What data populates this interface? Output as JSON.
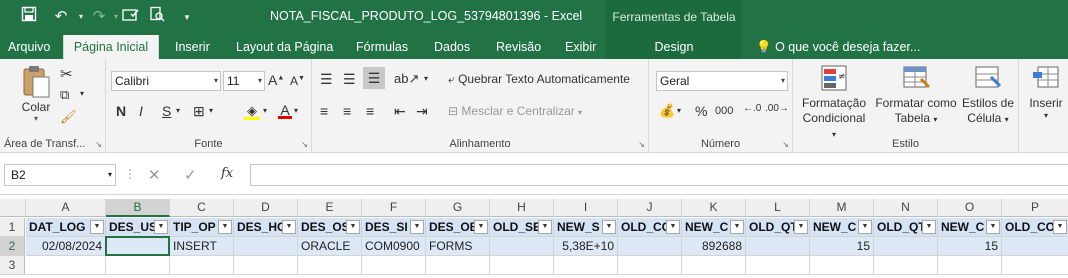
{
  "window": {
    "title": "NOTA_FISCAL_PRODUTO_LOG_53794801396 - Excel",
    "context_label": "Ferramentas de Tabela"
  },
  "tabs": [
    "Arquivo",
    "Página Inicial",
    "Inserir",
    "Layout da Página",
    "Fórmulas",
    "Dados",
    "Revisão",
    "Exibir",
    "Design"
  ],
  "tell_me": "O que você deseja fazer...",
  "ribbon": {
    "clipboard": {
      "paste": "Colar",
      "label": "Área de Transf..."
    },
    "font": {
      "name": "Calibri",
      "size": "11",
      "bold": "N",
      "italic": "I",
      "underline": "S",
      "label": "Fonte"
    },
    "alignment": {
      "wrap": "Quebrar Texto Automaticamente",
      "merge": "Mesclar e Centralizar",
      "label": "Alinhamento"
    },
    "number": {
      "format": "Geral",
      "percent": "%",
      "comma": "000",
      "label": "Número"
    },
    "styles": {
      "conditional": [
        "Formatação",
        "Condicional"
      ],
      "as_table": [
        "Formatar como",
        "Tabela"
      ],
      "cell_styles": [
        "Estilos de",
        "Célula"
      ],
      "label": "Estilo"
    },
    "cells": {
      "insert": "Inserir"
    }
  },
  "formula_bar": {
    "name_box": "B2",
    "fx": "fx",
    "value": ""
  },
  "columns": [
    "A",
    "B",
    "C",
    "D",
    "E",
    "F",
    "G",
    "H",
    "I",
    "J",
    "K",
    "L",
    "M",
    "N",
    "O",
    "P"
  ],
  "rows": [
    "1",
    "2",
    "3"
  ],
  "header_row": [
    "DAT_LOG",
    "DES_US",
    "TIP_OP",
    "DES_HO",
    "DES_OS",
    "DES_SI",
    "DES_OB",
    "OLD_SE",
    "NEW_S",
    "OLD_CO",
    "NEW_C",
    "OLD_QT",
    "NEW_C",
    "OLD_QT",
    "NEW_C",
    "OLD_CO"
  ],
  "data_row": [
    "02/08/2024",
    "",
    "INSERT",
    "",
    "ORACLE",
    "COM0900",
    "FORMS",
    "",
    "5,38E+10",
    "",
    "892688",
    "",
    "15",
    "",
    "15",
    ""
  ]
}
